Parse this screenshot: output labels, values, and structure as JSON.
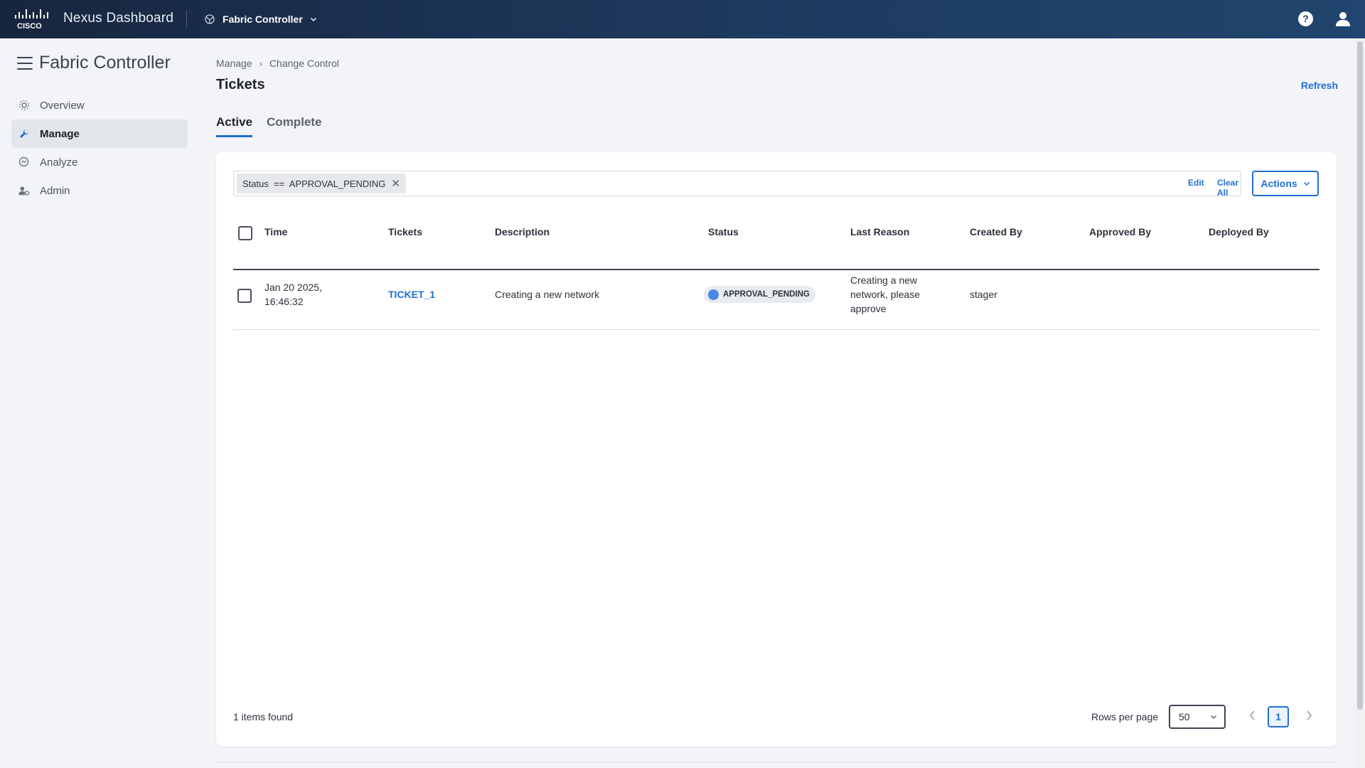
{
  "header": {
    "app_name": "Nexus Dashboard",
    "service_label": "Fabric Controller",
    "help_glyph": "?",
    "logo_text": "CISCO"
  },
  "sidebar": {
    "title": "Fabric Controller",
    "items": [
      {
        "label": "Overview",
        "icon": "overview-icon"
      },
      {
        "label": "Manage",
        "icon": "wrench-icon",
        "active": true
      },
      {
        "label": "Analyze",
        "icon": "analyze-icon"
      },
      {
        "label": "Admin",
        "icon": "admin-user-icon"
      }
    ]
  },
  "breadcrumb": {
    "items": [
      "Manage",
      "Change Control"
    ],
    "separator": "›"
  },
  "page": {
    "title": "Tickets",
    "refresh_label": "Refresh"
  },
  "tabs": [
    {
      "label": "Active",
      "active": true
    },
    {
      "label": "Complete",
      "active": false
    }
  ],
  "filter": {
    "chip_text": "Status  ==  APPROVAL_PENDING",
    "remove_glyph": "✕",
    "edit_label": "Edit",
    "clear_label": "Clear All"
  },
  "actions": {
    "label": "Actions"
  },
  "table": {
    "columns": [
      "Time",
      "Tickets",
      "Description",
      "Status",
      "Last Reason",
      "Created By",
      "Approved By",
      "Deployed By"
    ],
    "rows": [
      {
        "time_line1": "Jan 20 2025,",
        "time_line2": "16:46:32",
        "ticket": "TICKET_1",
        "description": "Creating a new network",
        "status": "APPROVAL_PENDING",
        "last_reason_line1": "Creating a new",
        "last_reason_line2": "network, please",
        "last_reason_line3": "approve",
        "created_by": "stager",
        "approved_by": "",
        "deployed_by": ""
      }
    ]
  },
  "footer": {
    "items_found": "1 items found",
    "rows_per_page_label": "Rows per page",
    "rows_per_page_value": "50",
    "current_page": "1"
  },
  "colors": {
    "accent": "#1f6fd1",
    "header_dark": "#17263f",
    "status_dot": "#4a88e6"
  }
}
